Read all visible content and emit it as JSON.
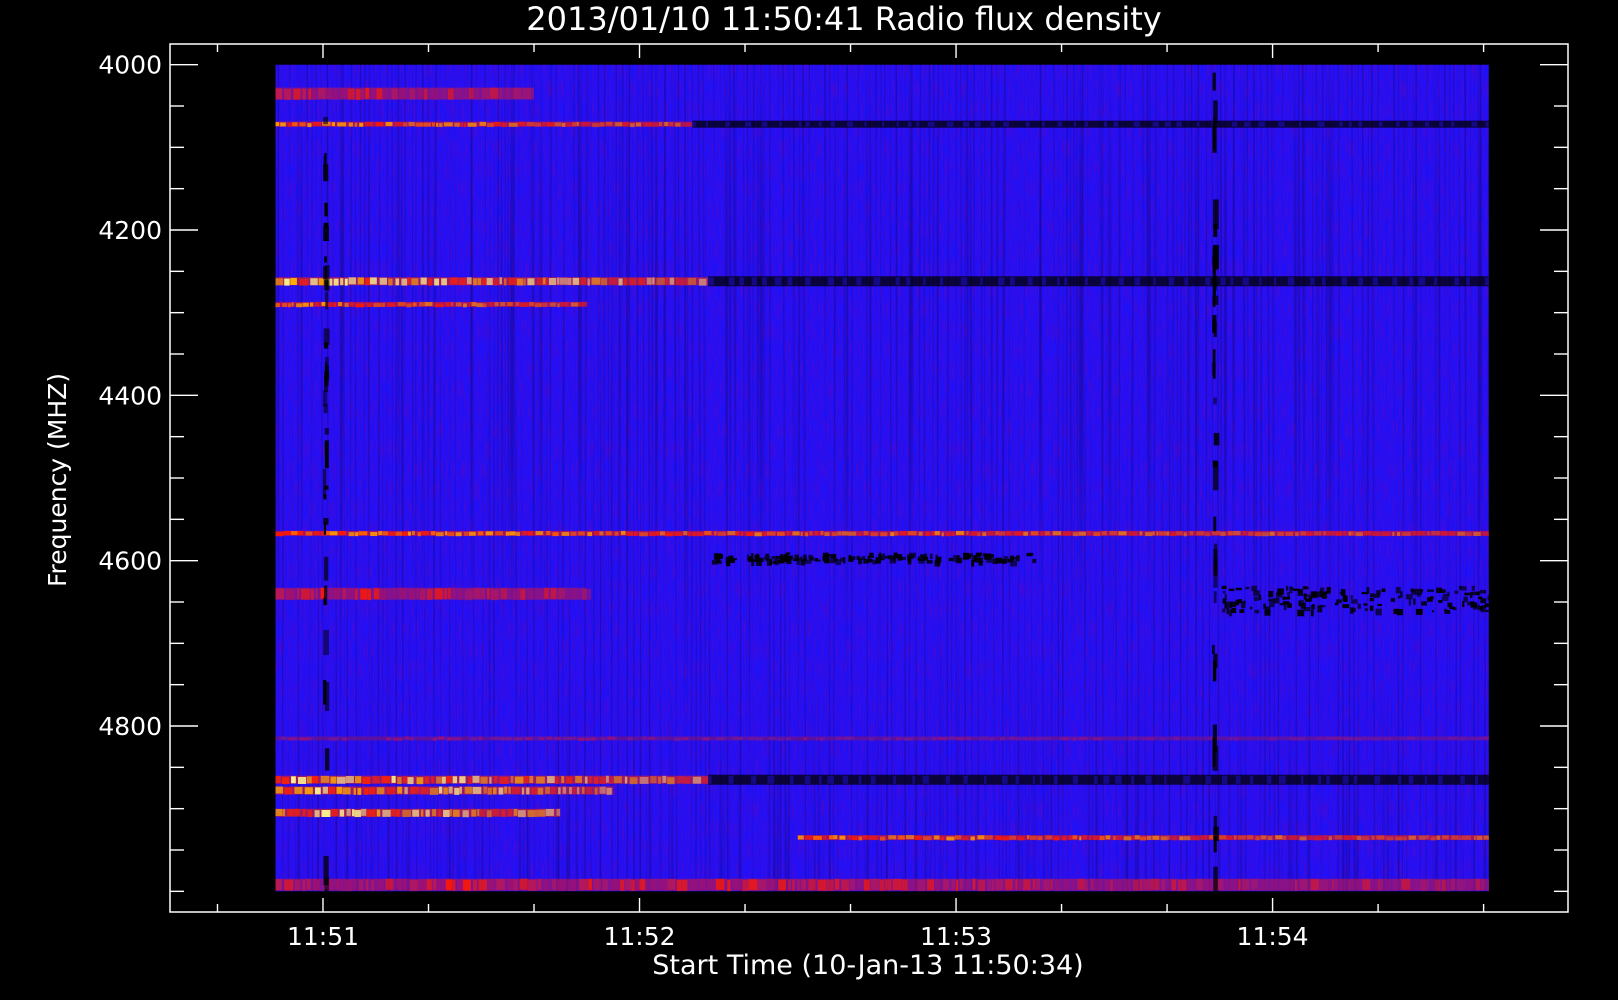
{
  "chart_data": {
    "type": "heatmap",
    "title": "2013/01/10 11:50:41 Radio flux density",
    "xlabel": "Start Time (10-Jan-13 11:50:34)",
    "ylabel": "Frequency (MHZ)",
    "x_axis": {
      "unit": "time",
      "range": [
        "11:50:31",
        "11:54:56"
      ],
      "data_range": [
        "11:50:51",
        "11:54:41"
      ],
      "major_ticks": [
        "11:51",
        "11:52",
        "11:53",
        "11:54"
      ],
      "minor_tick_interval_seconds": 20
    },
    "y_axis": {
      "unit": "MHz",
      "range": [
        3975,
        5025
      ],
      "data_range": [
        4000,
        5000
      ],
      "inverted": true,
      "major_ticks": [
        4000,
        4200,
        4400,
        4600,
        4800
      ],
      "minor_tick_interval": 50
    },
    "colormap": [
      "#000000",
      "#1a10ff",
      "#8a1aa0",
      "#ff1a00",
      "#ffa000",
      "#ffff80"
    ],
    "background_level": "blue",
    "features": [
      {
        "kind": "horizontal_band",
        "freq": 4035,
        "intensity": "medium",
        "time_range": [
          "11:50:51",
          "11:51:40"
        ]
      },
      {
        "kind": "horizontal_band",
        "freq": 4072,
        "intensity": "high",
        "time_range": [
          "11:50:51",
          "11:52:10"
        ],
        "then": "dark"
      },
      {
        "kind": "horizontal_band",
        "freq": 4262,
        "intensity": "very_high",
        "time_range": [
          "11:50:51",
          "11:52:13"
        ],
        "then": "dark"
      },
      {
        "kind": "horizontal_band",
        "freq": 4290,
        "intensity": "high",
        "time_range": [
          "11:50:51",
          "11:51:50"
        ]
      },
      {
        "kind": "horizontal_band",
        "freq": 4567,
        "intensity": "high",
        "time_range": [
          "11:50:51",
          "11:54:41"
        ]
      },
      {
        "kind": "horizontal_band",
        "freq": 4640,
        "intensity": "medium",
        "time_range": [
          "11:50:51",
          "11:51:50"
        ]
      },
      {
        "kind": "horizontal_band",
        "freq": 4815,
        "intensity": "low",
        "time_range": [
          "11:50:51",
          "11:54:41"
        ]
      },
      {
        "kind": "horizontal_band",
        "freq": 4865,
        "intensity": "very_high",
        "time_range": [
          "11:50:51",
          "11:52:13"
        ],
        "then": "dark"
      },
      {
        "kind": "horizontal_band",
        "freq": 4878,
        "intensity": "very_high",
        "time_range": [
          "11:50:51",
          "11:51:55"
        ]
      },
      {
        "kind": "horizontal_band",
        "freq": 4905,
        "intensity": "very_high",
        "time_range": [
          "11:50:51",
          "11:51:45"
        ]
      },
      {
        "kind": "horizontal_band",
        "freq": 4935,
        "intensity": "high",
        "time_range": [
          "11:52:30",
          "11:54:41"
        ]
      },
      {
        "kind": "horizontal_band",
        "freq": 4992,
        "intensity": "medium",
        "time_range": [
          "11:50:51",
          "11:54:41"
        ]
      },
      {
        "kind": "dark_column",
        "time": "11:51:01",
        "width_seconds": 2
      },
      {
        "kind": "dark_column",
        "time": "11:53:50",
        "width_seconds": 3
      },
      {
        "kind": "dark_patch",
        "time_range": [
          "11:53:50",
          "11:54:41"
        ],
        "freq_range": [
          4630,
          4660
        ]
      },
      {
        "kind": "dark_patch",
        "time_range": [
          "11:52:13",
          "11:53:15"
        ],
        "freq_range": [
          4590,
          4600
        ]
      }
    ]
  }
}
